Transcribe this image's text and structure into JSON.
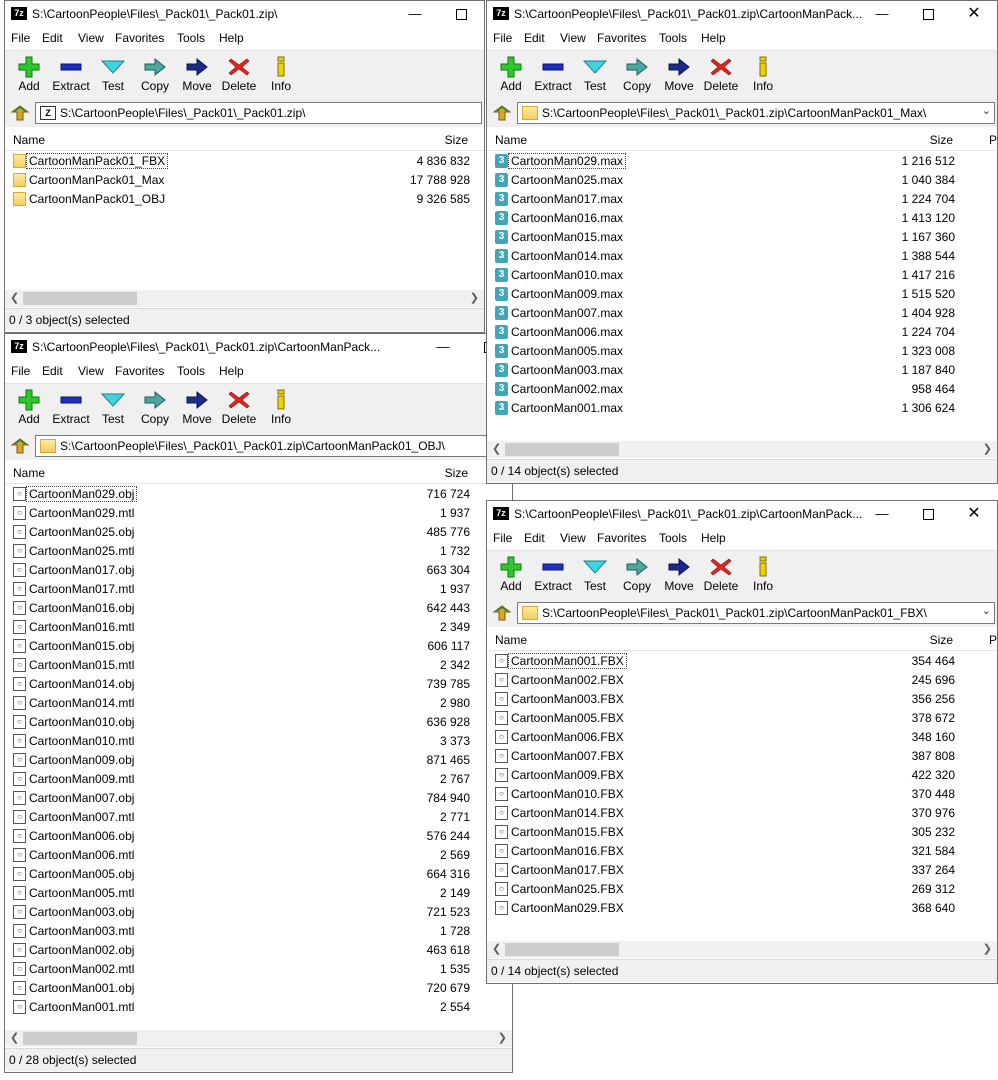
{
  "windows": [
    {
      "id": "w1",
      "title": "S:\\CartoonPeople\\Files\\_Pack01\\_Pack01.zip\\",
      "menu": [
        "File",
        "Edit",
        "View",
        "Favorites",
        "Tools",
        "Help"
      ],
      "toolbar": [
        "Add",
        "Extract",
        "Test",
        "Copy",
        "Move",
        "Delete",
        "Info"
      ],
      "address": "S:\\CartoonPeople\\Files\\_Pack01\\_Pack01.zip\\",
      "col_name": "Name",
      "col_size": "Size",
      "icon_type": "folder",
      "files": [
        {
          "name": "CartoonManPack01_FBX",
          "size": "4 836 832"
        },
        {
          "name": "CartoonManPack01_Max",
          "size": "17 788 928"
        },
        {
          "name": "CartoonManPack01_OBJ",
          "size": "9 326 585"
        }
      ],
      "status": "0 / 3 object(s) selected"
    },
    {
      "id": "w2",
      "title": "S:\\CartoonPeople\\Files\\_Pack01\\_Pack01.zip\\CartoonManPack...",
      "menu": [
        "File",
        "Edit",
        "View",
        "Favorites",
        "Tools",
        "Help"
      ],
      "toolbar": [
        "Add",
        "Extract",
        "Test",
        "Copy",
        "Move",
        "Delete",
        "Info"
      ],
      "address": "S:\\CartoonPeople\\Files\\_Pack01\\_Pack01.zip\\CartoonManPack01_Max\\",
      "col_name": "Name",
      "col_size": "Size",
      "col_extra": "P",
      "icon_type": "max",
      "files": [
        {
          "name": "CartoonMan029.max",
          "size": "1 216 512"
        },
        {
          "name": "CartoonMan025.max",
          "size": "1 040 384"
        },
        {
          "name": "CartoonMan017.max",
          "size": "1 224 704"
        },
        {
          "name": "CartoonMan016.max",
          "size": "1 413 120"
        },
        {
          "name": "CartoonMan015.max",
          "size": "1 167 360"
        },
        {
          "name": "CartoonMan014.max",
          "size": "1 388 544"
        },
        {
          "name": "CartoonMan010.max",
          "size": "1 417 216"
        },
        {
          "name": "CartoonMan009.max",
          "size": "1 515 520"
        },
        {
          "name": "CartoonMan007.max",
          "size": "1 404 928"
        },
        {
          "name": "CartoonMan006.max",
          "size": "1 224 704"
        },
        {
          "name": "CartoonMan005.max",
          "size": "1 323 008"
        },
        {
          "name": "CartoonMan003.max",
          "size": "1 187 840"
        },
        {
          "name": "CartoonMan002.max",
          "size": "958 464"
        },
        {
          "name": "CartoonMan001.max",
          "size": "1 306 624"
        }
      ],
      "status": "0 / 14 object(s) selected"
    },
    {
      "id": "w3",
      "title": "S:\\CartoonPeople\\Files\\_Pack01\\_Pack01.zip\\CartoonManPack...",
      "menu": [
        "File",
        "Edit",
        "View",
        "Favorites",
        "Tools",
        "Help"
      ],
      "toolbar": [
        "Add",
        "Extract",
        "Test",
        "Copy",
        "Move",
        "Delete",
        "Info"
      ],
      "address": "S:\\CartoonPeople\\Files\\_Pack01\\_Pack01.zip\\CartoonManPack01_OBJ\\",
      "col_name": "Name",
      "col_size": "Size",
      "icon_type": "obj",
      "files": [
        {
          "name": "CartoonMan029.obj",
          "size": "716 724"
        },
        {
          "name": "CartoonMan029.mtl",
          "size": "1 937"
        },
        {
          "name": "CartoonMan025.obj",
          "size": "485 776"
        },
        {
          "name": "CartoonMan025.mtl",
          "size": "1 732"
        },
        {
          "name": "CartoonMan017.obj",
          "size": "663 304"
        },
        {
          "name": "CartoonMan017.mtl",
          "size": "1 937"
        },
        {
          "name": "CartoonMan016.obj",
          "size": "642 443"
        },
        {
          "name": "CartoonMan016.mtl",
          "size": "2 349"
        },
        {
          "name": "CartoonMan015.obj",
          "size": "606 117"
        },
        {
          "name": "CartoonMan015.mtl",
          "size": "2 342"
        },
        {
          "name": "CartoonMan014.obj",
          "size": "739 785"
        },
        {
          "name": "CartoonMan014.mtl",
          "size": "2 980"
        },
        {
          "name": "CartoonMan010.obj",
          "size": "636 928"
        },
        {
          "name": "CartoonMan010.mtl",
          "size": "3 373"
        },
        {
          "name": "CartoonMan009.obj",
          "size": "871 465"
        },
        {
          "name": "CartoonMan009.mtl",
          "size": "2 767"
        },
        {
          "name": "CartoonMan007.obj",
          "size": "784 940"
        },
        {
          "name": "CartoonMan007.mtl",
          "size": "2 771"
        },
        {
          "name": "CartoonMan006.obj",
          "size": "576 244"
        },
        {
          "name": "CartoonMan006.mtl",
          "size": "2 569"
        },
        {
          "name": "CartoonMan005.obj",
          "size": "664 316"
        },
        {
          "name": "CartoonMan005.mtl",
          "size": "2 149"
        },
        {
          "name": "CartoonMan003.obj",
          "size": "721 523"
        },
        {
          "name": "CartoonMan003.mtl",
          "size": "1 728"
        },
        {
          "name": "CartoonMan002.obj",
          "size": "463 618"
        },
        {
          "name": "CartoonMan002.mtl",
          "size": "1 535"
        },
        {
          "name": "CartoonMan001.obj",
          "size": "720 679"
        },
        {
          "name": "CartoonMan001.mtl",
          "size": "2 554"
        }
      ],
      "status": "0 / 28 object(s) selected"
    },
    {
      "id": "w4",
      "title": "S:\\CartoonPeople\\Files\\_Pack01\\_Pack01.zip\\CartoonManPack...",
      "menu": [
        "File",
        "Edit",
        "View",
        "Favorites",
        "Tools",
        "Help"
      ],
      "toolbar": [
        "Add",
        "Extract",
        "Test",
        "Copy",
        "Move",
        "Delete",
        "Info"
      ],
      "address": "S:\\CartoonPeople\\Files\\_Pack01\\_Pack01.zip\\CartoonManPack01_FBX\\",
      "col_name": "Name",
      "col_size": "Size",
      "col_extra": "P",
      "icon_type": "fbx",
      "files": [
        {
          "name": "CartoonMan001.FBX",
          "size": "354 464"
        },
        {
          "name": "CartoonMan002.FBX",
          "size": "245 696"
        },
        {
          "name": "CartoonMan003.FBX",
          "size": "356 256"
        },
        {
          "name": "CartoonMan005.FBX",
          "size": "378 672"
        },
        {
          "name": "CartoonMan006.FBX",
          "size": "348 160"
        },
        {
          "name": "CartoonMan007.FBX",
          "size": "387 808"
        },
        {
          "name": "CartoonMan009.FBX",
          "size": "422 320"
        },
        {
          "name": "CartoonMan010.FBX",
          "size": "370 448"
        },
        {
          "name": "CartoonMan014.FBX",
          "size": "370 976"
        },
        {
          "name": "CartoonMan015.FBX",
          "size": "305 232"
        },
        {
          "name": "CartoonMan016.FBX",
          "size": "321 584"
        },
        {
          "name": "CartoonMan017.FBX",
          "size": "337 264"
        },
        {
          "name": "CartoonMan025.FBX",
          "size": "269 312"
        },
        {
          "name": "CartoonMan029.FBX",
          "size": "368 640"
        }
      ],
      "status": "0 / 14 object(s) selected"
    }
  ]
}
